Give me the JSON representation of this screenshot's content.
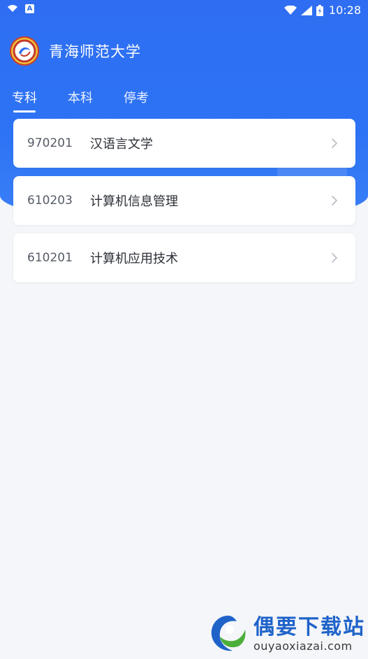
{
  "status_bar": {
    "left_icons": [
      "wifi-icon",
      "notification-a-icon"
    ],
    "a_label": "A",
    "right_icons": [
      "wifi-signal-icon",
      "cell-signal-icon",
      "battery-icon"
    ],
    "time": "10:28"
  },
  "header": {
    "logo_icon": "school-logo-icon",
    "school_name": "青海师范大学"
  },
  "tabs": [
    {
      "label": "专科",
      "active": true
    },
    {
      "label": "本科",
      "active": false
    },
    {
      "label": "停考",
      "active": false
    }
  ],
  "majors": [
    {
      "code": "970201",
      "name": "汉语言文学"
    },
    {
      "code": "610203",
      "name": "计算机信息管理"
    },
    {
      "code": "610201",
      "name": "计算机应用技术"
    }
  ],
  "watermark": {
    "logo_icon": "site-logo-icon",
    "title": "偶要下载站",
    "url": "ouyaoxiazai.com"
  },
  "colors": {
    "primary": "#2f6ef2",
    "background": "#f4f6f9",
    "card": "#ffffff",
    "watermark_blue": "#1f63c9"
  }
}
